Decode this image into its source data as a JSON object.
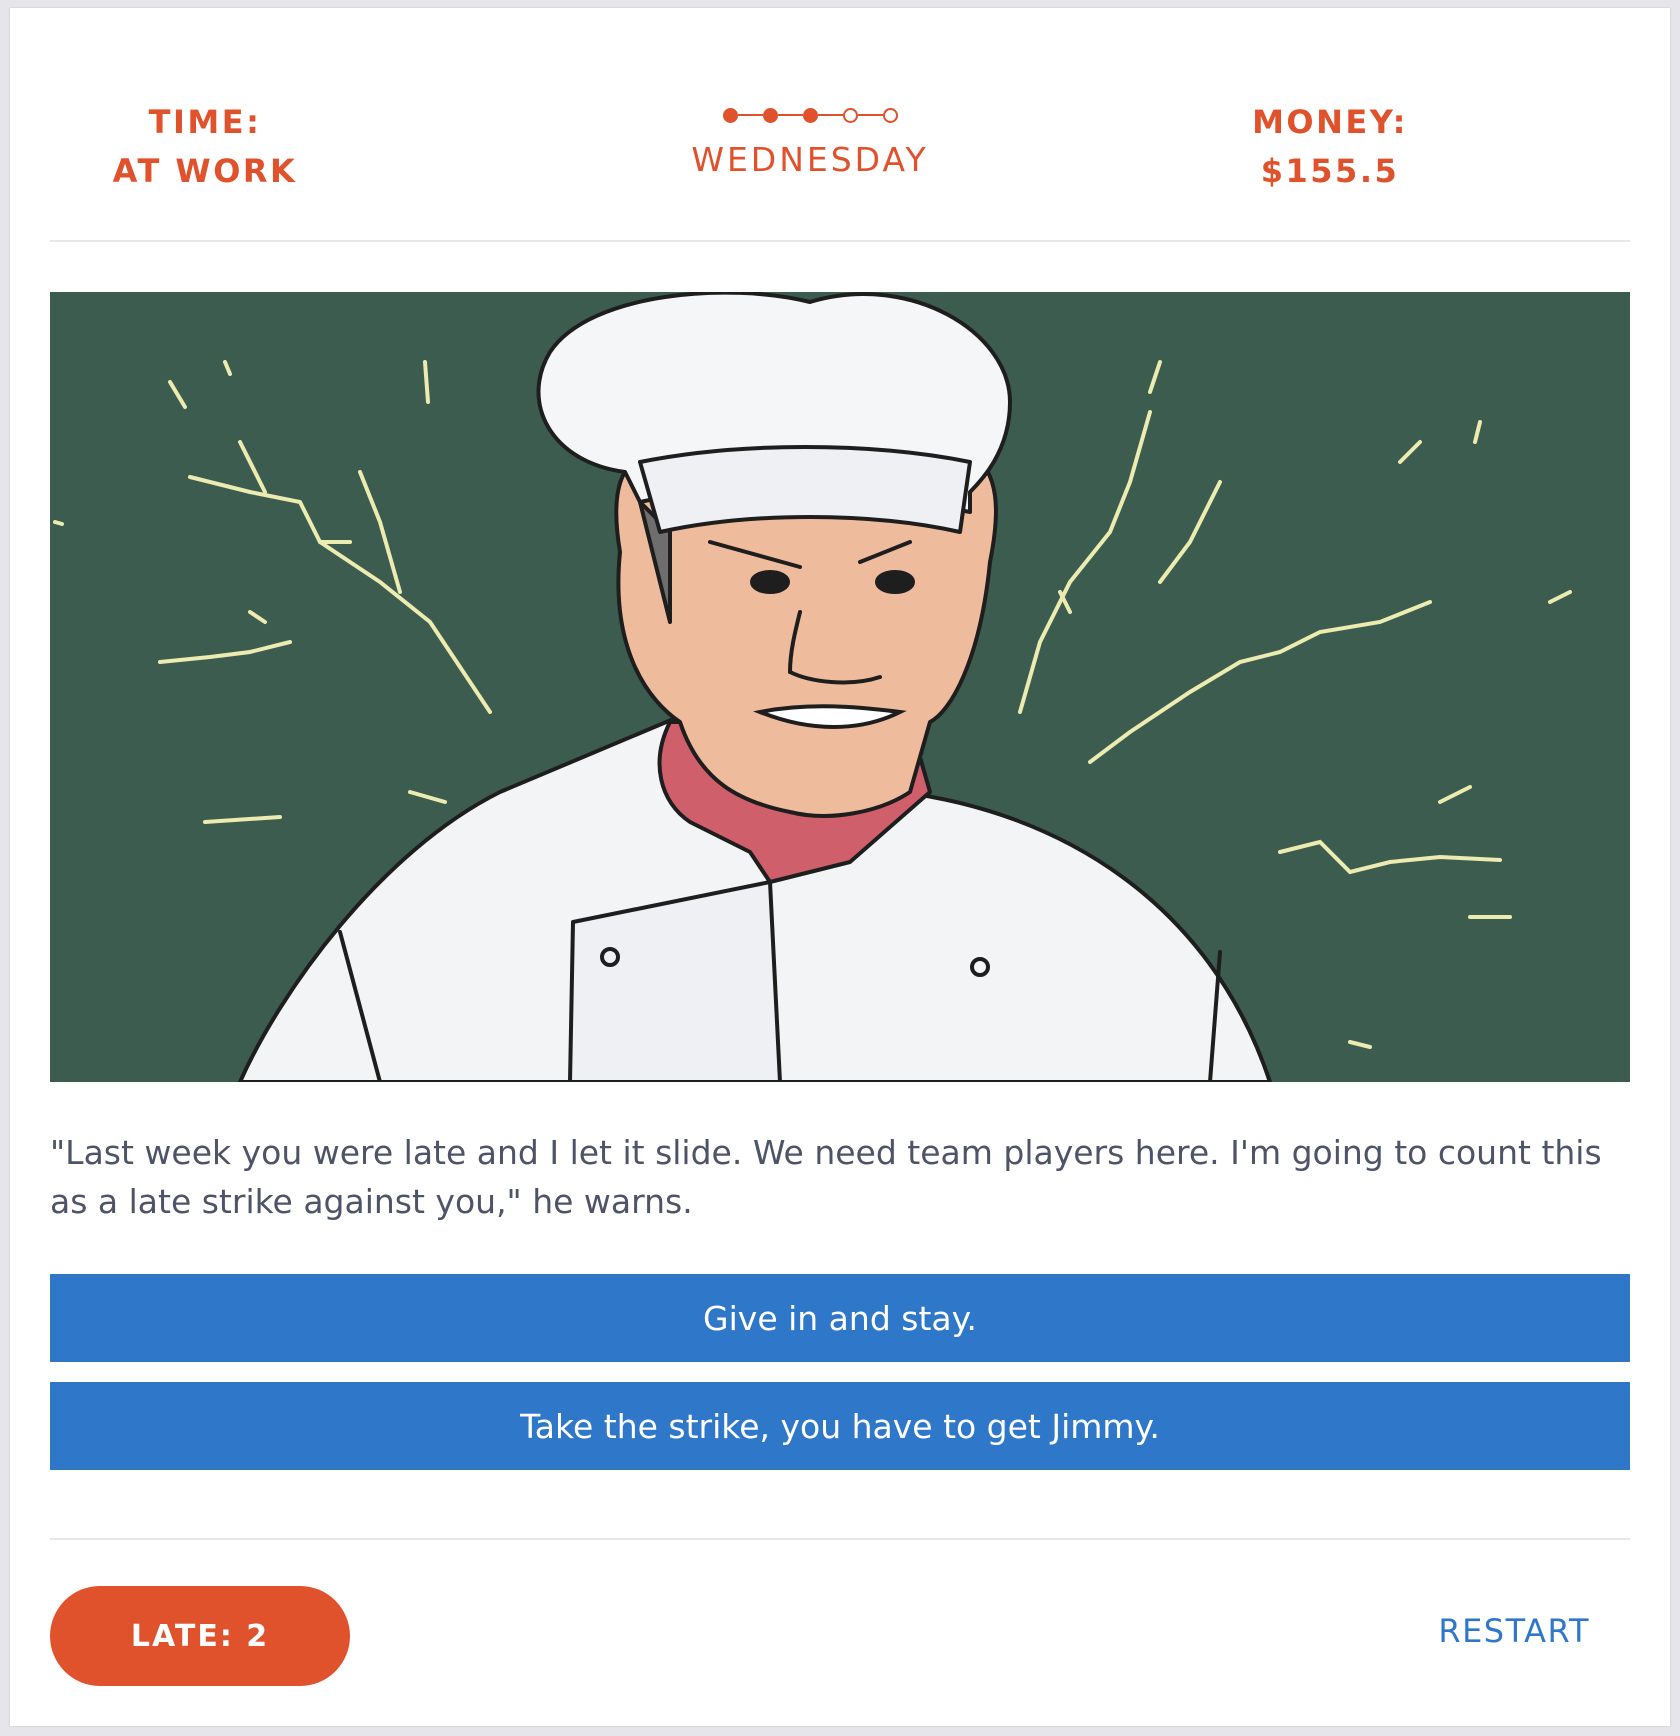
{
  "header": {
    "time_label": "TIME:",
    "time_value": "AT WORK",
    "day_name": "WEDNESDAY",
    "day_progress": {
      "current": 3,
      "total": 5
    },
    "money_label": "MONEY:",
    "money_value": "$155.5"
  },
  "scene": {
    "illustration": "angry-chef-illustration",
    "background_color": "#3d5c50"
  },
  "story": {
    "text": "\"Last week you were late and I let it slide. We need team players here. I'm going to count this as a late strike against you,\" he warns."
  },
  "choices": [
    {
      "label": "Give in and stay."
    },
    {
      "label": "Take the strike, you have to get Jimmy."
    }
  ],
  "footer": {
    "late_badge": "LATE: 2",
    "restart_label": "RESTART"
  },
  "colors": {
    "accent": "#e0522c",
    "button": "#2f78c9",
    "text": "#4e5468"
  }
}
